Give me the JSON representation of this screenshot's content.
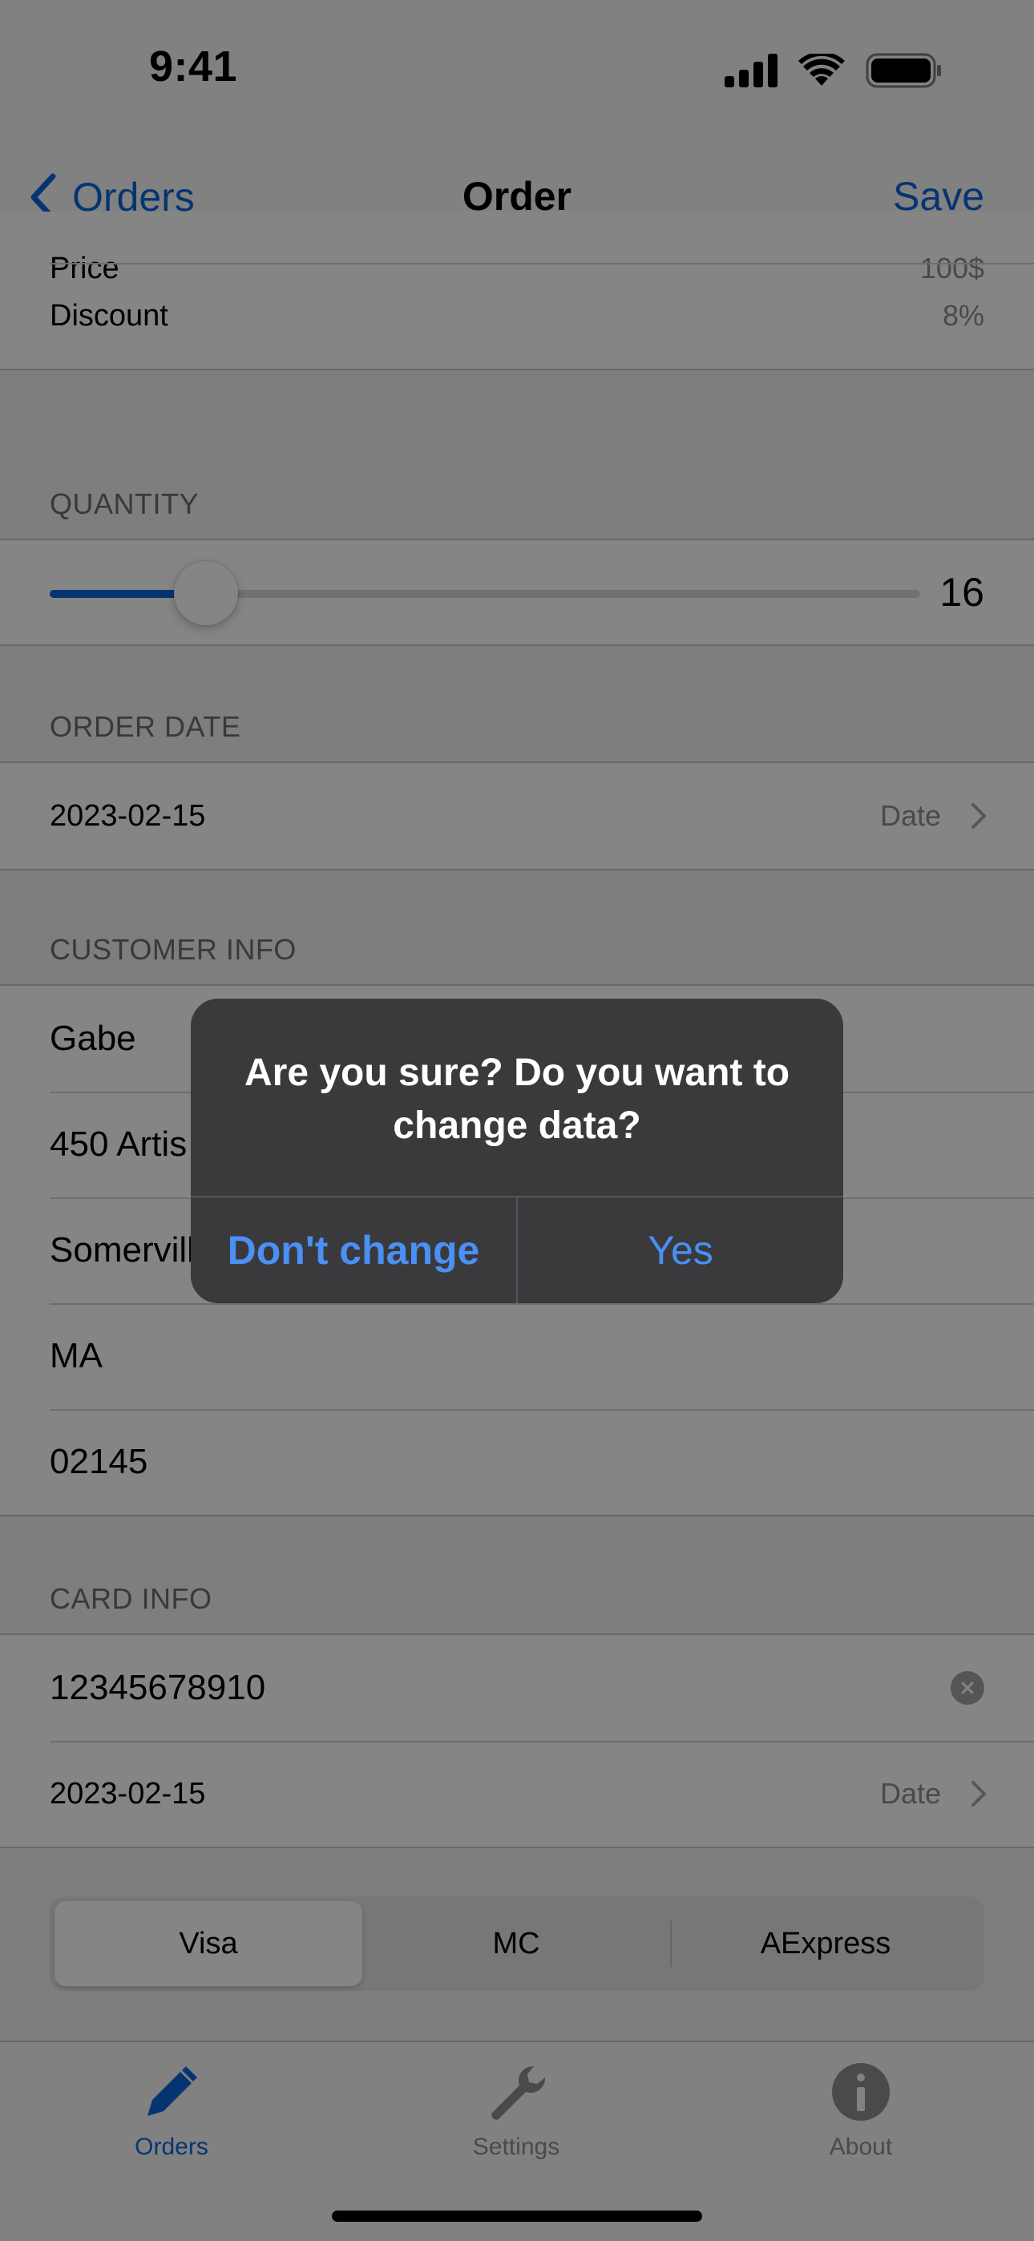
{
  "status_bar": {
    "time": "9:41"
  },
  "nav": {
    "back_label": "Orders",
    "title": "Order",
    "save_label": "Save"
  },
  "pricing": {
    "price_label": "Price",
    "price_value": "100$",
    "discount_label": "Discount",
    "discount_value": "8%"
  },
  "quantity": {
    "header": "QUANTITY",
    "value": "16",
    "fraction": 0.18
  },
  "order_date": {
    "header": "ORDER DATE",
    "value": "2023-02-15",
    "picker_label": "Date"
  },
  "customer": {
    "header": "CUSTOMER INFO",
    "name": "Gabe",
    "street": "450 Artis",
    "city": "Somervill",
    "state": "MA",
    "zip": "02145"
  },
  "card": {
    "header": "CARD INFO",
    "number": "12345678910",
    "expiry": "2023-02-15",
    "picker_label": "Date",
    "types": [
      "Visa",
      "MC",
      "AExpress"
    ],
    "selected": "Visa"
  },
  "tabs": [
    {
      "label": "Orders",
      "icon": "pencil-icon",
      "active": true
    },
    {
      "label": "Settings",
      "icon": "wrench-icon",
      "active": false
    },
    {
      "label": "About",
      "icon": "info-icon",
      "active": false
    }
  ],
  "alert": {
    "title": "Are you sure? Do you want to change data?",
    "cancel_label": "Don't change",
    "confirm_label": "Yes"
  },
  "colors": {
    "accent": "#0a66d8",
    "alert_bg": "#3a3a3c",
    "alert_button": "#4a90f5"
  }
}
